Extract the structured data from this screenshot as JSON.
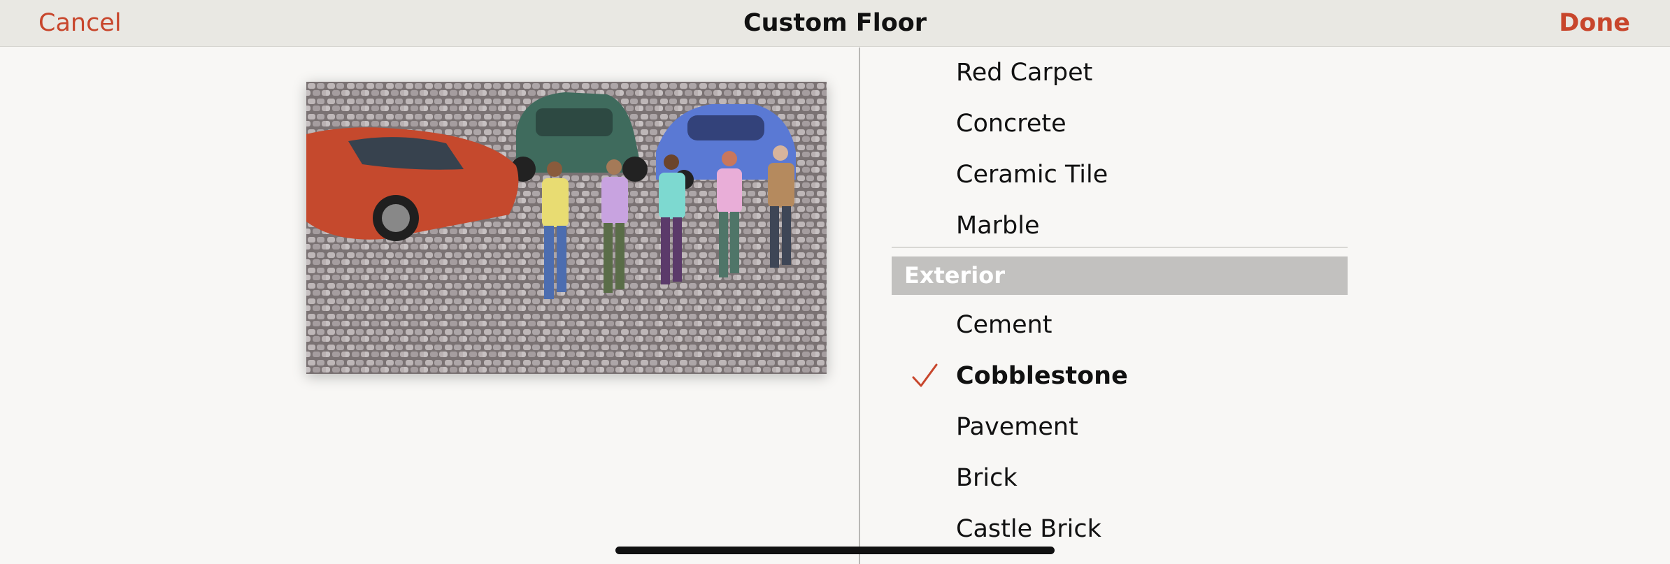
{
  "nav": {
    "cancel_label": "Cancel",
    "title": "Custom Floor",
    "done_label": "Done"
  },
  "preview": {
    "description_icon": "floor-preview-image"
  },
  "floor_list": {
    "items_top": [
      {
        "label": "Red Carpet"
      },
      {
        "label": "Concrete"
      },
      {
        "label": "Ceramic Tile"
      },
      {
        "label": "Marble"
      }
    ],
    "section_exterior": "Exterior",
    "items_exterior": [
      {
        "label": "Cement",
        "selected": false
      },
      {
        "label": "Cobblestone",
        "selected": true
      },
      {
        "label": "Pavement",
        "selected": false
      },
      {
        "label": "Brick",
        "selected": false
      },
      {
        "label": "Castle Brick",
        "selected": false
      }
    ]
  },
  "colors": {
    "accent": "#c8462c",
    "nav_background": "#e9e8e3",
    "section_header": "#c2c1bf"
  }
}
